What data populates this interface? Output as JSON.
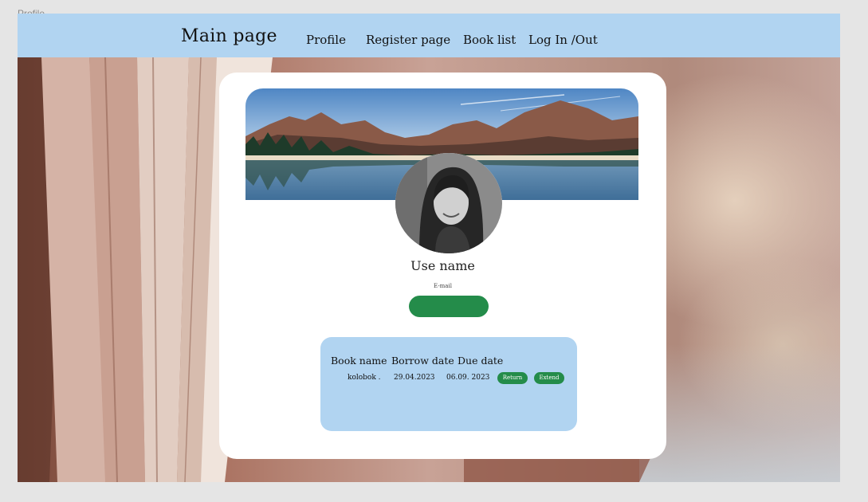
{
  "frame": {
    "label": "Profile"
  },
  "navbar": {
    "brand": "Main page",
    "links": [
      "Profile",
      "Register page",
      "Book list",
      "Log In /Out"
    ],
    "background": "#b1d4f1"
  },
  "profile": {
    "banner_image": "mountain-lake-image",
    "avatar_image": "user-photo",
    "username": "Use name",
    "email": "E-mail",
    "button_color": "#248c4a"
  },
  "loans": {
    "headers": [
      "Book name",
      "Borrow date",
      "Due date"
    ],
    "rows": [
      {
        "book": "kolobok .",
        "borrow_date": "29.04.2023",
        "due_date": "06.09. 2023",
        "return_label": "Return",
        "extend_label": "Extend"
      }
    ]
  },
  "colors": {
    "accent": "#248c4a",
    "panel": "#b1d4f1",
    "card": "#ffffff"
  }
}
